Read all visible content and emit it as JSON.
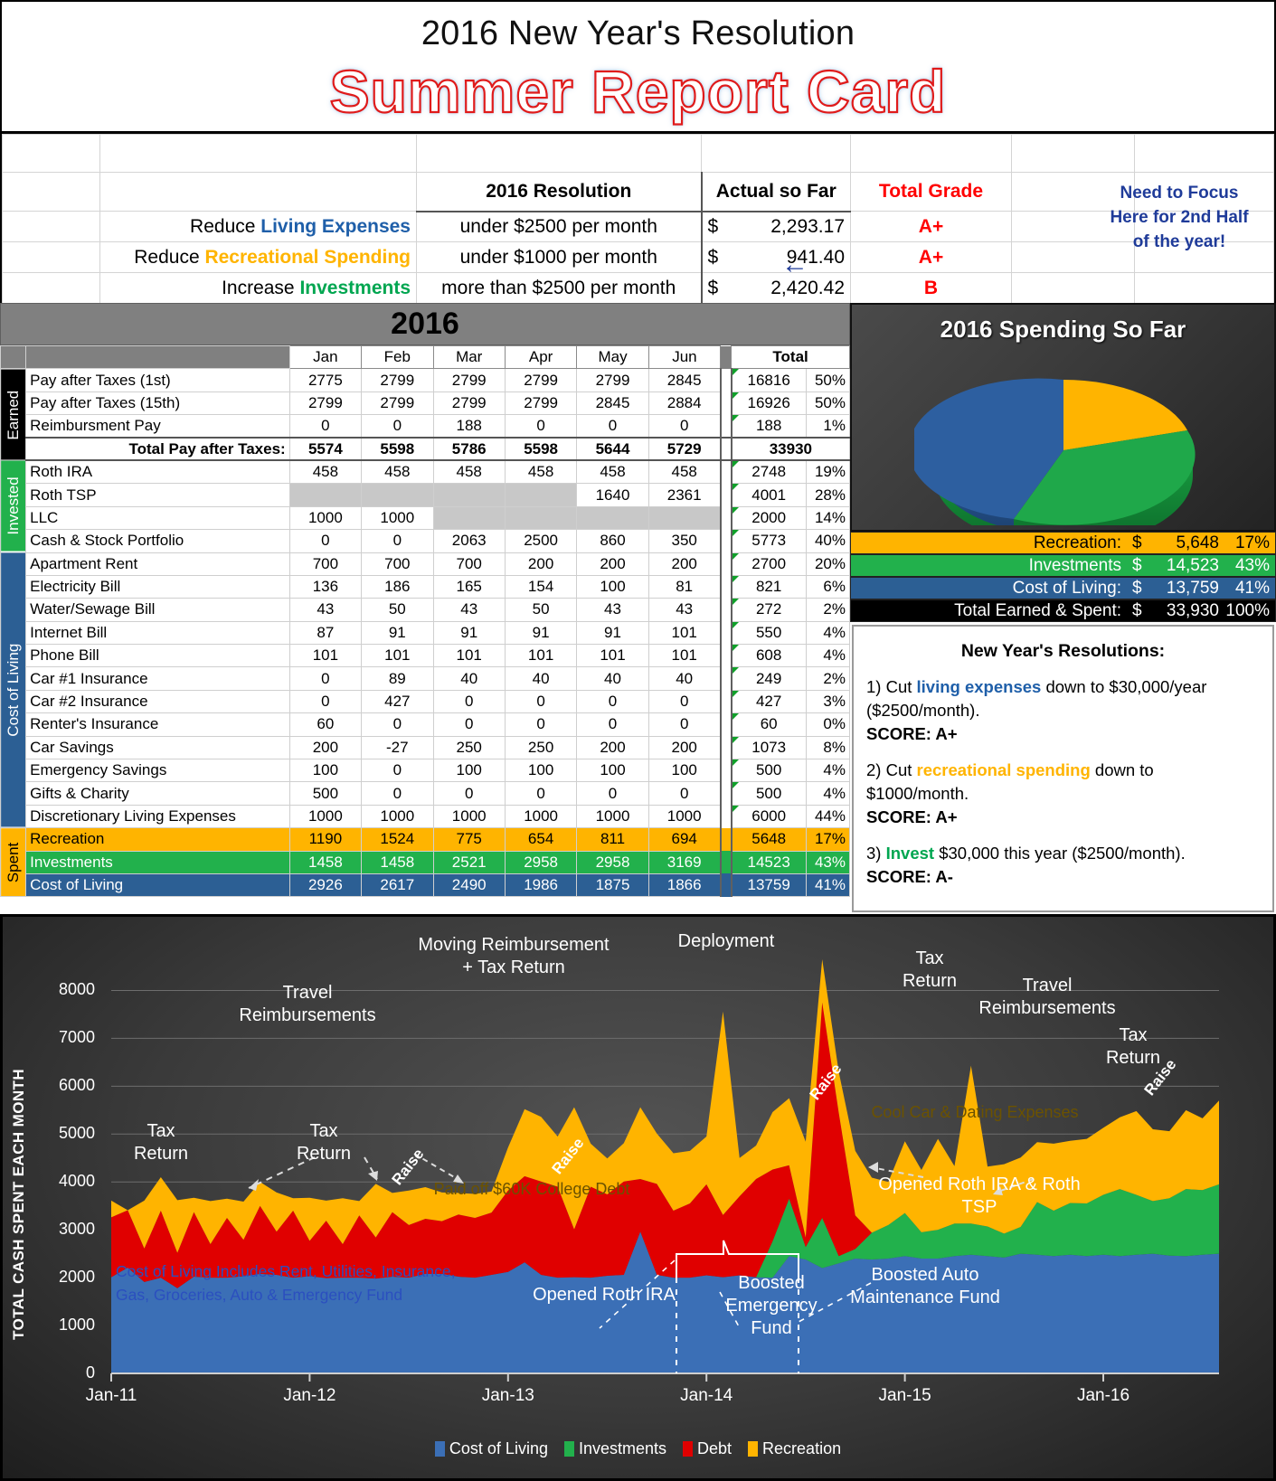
{
  "title": {
    "subtitle": "2016 New Year's Resolution",
    "main": "Summer Report Card"
  },
  "summary": {
    "headers": {
      "resolution": "2016 Resolution",
      "actual": "Actual so Far",
      "grade": "Total Grade"
    },
    "rows": [
      {
        "prefix": "Reduce ",
        "highlight": "Living Expenses",
        "highlight_color": "#1f5fa9",
        "target": "under $2500 per month",
        "dollar": "$",
        "amount": "2,293.17",
        "grade": "A+"
      },
      {
        "prefix": "Reduce ",
        "highlight": "Recreational Spending",
        "highlight_color": "#ffb400",
        "target": "under $1000 per month",
        "dollar": "$",
        "amount": "941.40",
        "grade": "A+"
      },
      {
        "prefix": "Increase ",
        "highlight": "Investments",
        "highlight_color": "#00a650",
        "target": "more than $2500 per month",
        "dollar": "$",
        "amount": "2,420.42",
        "grade": "B"
      }
    ],
    "focus_note": "Need to Focus Here for 2nd Half of the year!",
    "focus_line1": "Need to Focus",
    "focus_line2": "Here for 2nd Half",
    "focus_line3": "of the year!",
    "arrow": "←"
  },
  "budget": {
    "year": "2016",
    "months": [
      "Jan",
      "Feb",
      "Mar",
      "Apr",
      "May",
      "Jun"
    ],
    "total_header": "Total",
    "side_labels": {
      "earned": "Earned",
      "invested": "Invested",
      "cost_of_living": "Cost of Living",
      "spent": "Spent"
    },
    "earned_rows": [
      {
        "label": "Pay after Taxes (1st)",
        "values": [
          "2775",
          "2799",
          "2799",
          "2799",
          "2799",
          "2845"
        ],
        "total": "16816",
        "pct": "50%"
      },
      {
        "label": "Pay after Taxes (15th)",
        "values": [
          "2799",
          "2799",
          "2799",
          "2799",
          "2845",
          "2884"
        ],
        "total": "16926",
        "pct": "50%"
      },
      {
        "label": "Reimbursment Pay",
        "values": [
          "0",
          "0",
          "188",
          "0",
          "0",
          "0"
        ],
        "total": "188",
        "pct": "1%"
      }
    ],
    "total_row": {
      "label": "Total Pay after Taxes:",
      "values": [
        "5574",
        "5598",
        "5786",
        "5598",
        "5644",
        "5729"
      ],
      "total": "33930",
      "pct": ""
    },
    "invested_rows": [
      {
        "label": "Roth IRA",
        "values": [
          "458",
          "458",
          "458",
          "458",
          "458",
          "458"
        ],
        "total": "2748",
        "pct": "19%"
      },
      {
        "label": "Roth TSP",
        "values": [
          "",
          "",
          "",
          "",
          "1640",
          "2361"
        ],
        "total": "4001",
        "pct": "28%"
      },
      {
        "label": "LLC",
        "values": [
          "1000",
          "1000",
          "",
          "",
          "",
          ""
        ],
        "total": "2000",
        "pct": "14%"
      },
      {
        "label": "Cash & Stock Portfolio",
        "values": [
          "0",
          "0",
          "2063",
          "2500",
          "860",
          "350"
        ],
        "total": "5773",
        "pct": "40%"
      }
    ],
    "col_rows": [
      {
        "label": "Apartment Rent",
        "values": [
          "700",
          "700",
          "700",
          "200",
          "200",
          "200"
        ],
        "total": "2700",
        "pct": "20%"
      },
      {
        "label": "Electricity Bill",
        "values": [
          "136",
          "186",
          "165",
          "154",
          "100",
          "81"
        ],
        "total": "821",
        "pct": "6%"
      },
      {
        "label": "Water/Sewage Bill",
        "values": [
          "43",
          "50",
          "43",
          "50",
          "43",
          "43"
        ],
        "total": "272",
        "pct": "2%"
      },
      {
        "label": "Internet Bill",
        "values": [
          "87",
          "91",
          "91",
          "91",
          "91",
          "101"
        ],
        "total": "550",
        "pct": "4%"
      },
      {
        "label": "Phone Bill",
        "values": [
          "101",
          "101",
          "101",
          "101",
          "101",
          "101"
        ],
        "total": "608",
        "pct": "4%"
      },
      {
        "label": "Car #1 Insurance",
        "values": [
          "0",
          "89",
          "40",
          "40",
          "40",
          "40"
        ],
        "total": "249",
        "pct": "2%"
      },
      {
        "label": "Car #2 Insurance",
        "values": [
          "0",
          "427",
          "0",
          "0",
          "0",
          "0"
        ],
        "total": "427",
        "pct": "3%"
      },
      {
        "label": "Renter's Insurance",
        "values": [
          "60",
          "0",
          "0",
          "0",
          "0",
          "0"
        ],
        "total": "60",
        "pct": "0%"
      },
      {
        "label": "Car Savings",
        "values": [
          "200",
          "-27",
          "250",
          "250",
          "200",
          "200"
        ],
        "total": "1073",
        "pct": "8%"
      },
      {
        "label": "Emergency Savings",
        "values": [
          "100",
          "0",
          "100",
          "100",
          "100",
          "100"
        ],
        "total": "500",
        "pct": "4%"
      },
      {
        "label": "Gifts & Charity",
        "values": [
          "500",
          "0",
          "0",
          "0",
          "0",
          "0"
        ],
        "total": "500",
        "pct": "4%"
      },
      {
        "label": "Discretionary Living Expenses",
        "values": [
          "1000",
          "1000",
          "1000",
          "1000",
          "1000",
          "1000"
        ],
        "total": "6000",
        "pct": "44%"
      }
    ],
    "spent_rows": [
      {
        "label": "Recreation",
        "values": [
          "1190",
          "1524",
          "775",
          "654",
          "811",
          "694"
        ],
        "total": "5648",
        "pct": "17%",
        "style": "r-rec"
      },
      {
        "label": "Investments",
        "values": [
          "1458",
          "1458",
          "2521",
          "2958",
          "2958",
          "3169"
        ],
        "total": "14523",
        "pct": "43%",
        "style": "r-inv"
      },
      {
        "label": "Cost of Living",
        "values": [
          "2926",
          "2617",
          "2490",
          "1986",
          "1875",
          "1866"
        ],
        "total": "13759",
        "pct": "41%",
        "style": "r-col"
      }
    ]
  },
  "pie": {
    "title": "2016 Spending So Far",
    "legend": [
      {
        "label": "Recreation:",
        "dollar": "$",
        "amount": "5,648",
        "pct": "17%",
        "style": "lg-rec"
      },
      {
        "label": "Investments",
        "dollar": "$",
        "amount": "14,523",
        "pct": "43%",
        "style": "lg-inv"
      },
      {
        "label": "Cost of Living:",
        "dollar": "$",
        "amount": "13,759",
        "pct": "41%",
        "style": "lg-col"
      },
      {
        "label": "Total Earned & Spent:",
        "dollar": "$",
        "amount": "33,930",
        "pct": "100%",
        "style": "lg-tot"
      }
    ]
  },
  "resolutions": {
    "heading": "New Year's Resolutions:",
    "items": [
      {
        "pre": "1) Cut ",
        "hl": "living expenses",
        "hl_color": "#1f5fa9",
        "post": " down to $30,000/year ($2500/month).",
        "score": "SCORE: A+"
      },
      {
        "pre": "2) Cut ",
        "hl": "recreational spending",
        "hl_color": "#ffb400",
        "post": " down to $1000/month.",
        "score": "SCORE: A+"
      },
      {
        "pre": "3) ",
        "hl": "Invest",
        "hl_color": "#00a650",
        "post": " $30,000 this year ($2500/month).",
        "score": "SCORE: A-"
      }
    ]
  },
  "chart_data": {
    "type": "area",
    "title": "",
    "xlabel": "",
    "ylabel": "TOTAL CASH SPENT EACH MONTH",
    "ylim": [
      0,
      8500
    ],
    "yticks": [
      0,
      1000,
      2000,
      3000,
      4000,
      5000,
      6000,
      7000,
      8000
    ],
    "xticks": [
      "Jan-11",
      "Jan-12",
      "Jan-13",
      "Jan-14",
      "Jan-15",
      "Jan-16"
    ],
    "grid": true,
    "legend_position": "bottom",
    "stacked": true,
    "legend": [
      "Cost of Living",
      "Investments",
      "Debt",
      "Recreation"
    ],
    "colors": {
      "Cost of Living": "#3b6fb6",
      "Investments": "#22b14c",
      "Debt": "#e00000",
      "Recreation": "#ffb400"
    },
    "series": [
      {
        "name": "Cost of Living",
        "color": "#3b6fb6",
        "values": [
          2010,
          2210,
          1910,
          2000,
          1780,
          2020,
          2000,
          2000,
          2030,
          2080,
          2060,
          2000,
          2030,
          1990,
          2000,
          2000,
          1980,
          2020,
          2000,
          2080,
          2080,
          2020,
          2000,
          2060,
          2120,
          2320,
          2060,
          2000,
          2010,
          2000,
          2040,
          2060,
          2960,
          2060,
          2000,
          2000,
          2050,
          2010,
          2050,
          2010,
          2000,
          2450,
          2380,
          2200,
          2300,
          2400,
          2380,
          2400,
          2450,
          2400,
          2400,
          2450,
          2480,
          2450,
          2420,
          2500,
          2480,
          2450,
          2480,
          2450,
          2480,
          2450,
          2480,
          2500,
          2460,
          2450,
          2480,
          2500
        ]
      },
      {
        "name": "Investments",
        "color": "#22b14c",
        "values": [
          0,
          0,
          0,
          0,
          0,
          0,
          0,
          0,
          0,
          0,
          0,
          0,
          0,
          0,
          0,
          0,
          0,
          0,
          0,
          0,
          0,
          0,
          0,
          0,
          0,
          0,
          0,
          0,
          0,
          0,
          0,
          0,
          0,
          0,
          0,
          0,
          0,
          0,
          0,
          0,
          760,
          1200,
          260,
          1050,
          150,
          200,
          560,
          700,
          900,
          550,
          600,
          680,
          650,
          620,
          500,
          560,
          1100,
          950,
          1080,
          1100,
          1250,
          1400,
          1250,
          1100,
          1200,
          1400,
          1350,
          1450
        ]
      },
      {
        "name": "Debt",
        "color": "#e00000",
        "values": [
          1250,
          1200,
          700,
          1400,
          740,
          1350,
          700,
          1250,
          760,
          1420,
          900,
          1400,
          740,
          1200,
          700,
          1300,
          860,
          1350,
          1100,
          1150,
          1100,
          1300,
          1250,
          1300,
          1700,
          1800,
          1950,
          1900,
          1000,
          1900,
          1700,
          1950,
          1100,
          1900,
          1400,
          1550,
          1900,
          1300,
          1650,
          2050,
          1500,
          700,
          200,
          4500,
          3000,
          700,
          0,
          0,
          0,
          0,
          0,
          0,
          0,
          0,
          0,
          0,
          0,
          0,
          0,
          0,
          0,
          0,
          0,
          0,
          0,
          0,
          0,
          0
        ]
      },
      {
        "name": "Recreation",
        "color": "#ffb400",
        "values": [
          350,
          0,
          1000,
          700,
          1100,
          300,
          900,
          400,
          800,
          500,
          820,
          260,
          900,
          420,
          960,
          300,
          1120,
          400,
          720,
          660,
          600,
          450,
          500,
          440,
          900,
          1400,
          1350,
          1050,
          2550,
          900,
          750,
          800,
          1500,
          1050,
          1200,
          1100,
          1000,
          4250,
          800,
          700,
          1200,
          1400,
          2000,
          900,
          850,
          1350,
          1150,
          900,
          1500,
          1300,
          1900,
          1200,
          3300,
          1250,
          1450,
          1450,
          1250,
          1400,
          1300,
          1350,
          1400,
          1500,
          1750,
          1500,
          1400,
          1650,
          1500,
          1750
        ]
      }
    ],
    "annotations": [
      {
        "text": "Tax Return",
        "x": 0.1,
        "y": 0.62
      },
      {
        "text": "Travel Reimbursements",
        "x": 0.235,
        "y": 0.17
      },
      {
        "text": "Tax Return",
        "x": 0.245,
        "y": 0.65
      },
      {
        "text": "Moving Reimbursement + Tax Return",
        "x": 0.4,
        "y": 0.06
      },
      {
        "text": "Raise",
        "x": 0.3,
        "y": 0.69
      },
      {
        "text": "Raise",
        "x": 0.435,
        "y": 0.655
      },
      {
        "text": "Deployment",
        "x": 0.565,
        "y": 0.02
      },
      {
        "text": "Raise",
        "x": 0.625,
        "y": 0.63
      },
      {
        "text": "Tax Return",
        "x": 0.715,
        "y": 0.12
      },
      {
        "text": "Travel Reimbursements",
        "x": 0.8,
        "y": 0.15
      },
      {
        "text": "Tax Return",
        "x": 0.875,
        "y": 0.25
      },
      {
        "text": "Raise",
        "x": 0.905,
        "y": 0.315
      },
      {
        "text": "Paid off $60K College Debt",
        "x": 0.41,
        "y": 0.53
      },
      {
        "text": "Opened Roth IRA",
        "x": 0.465,
        "y": 0.875
      },
      {
        "text": "Boosted Emergency Fund",
        "x": 0.595,
        "y": 0.86
      },
      {
        "text": "Boosted Auto Maintenance Fund",
        "x": 0.705,
        "y": 0.845
      },
      {
        "text": "Opened Roth IRA & Roth TSP",
        "x": 0.755,
        "y": 0.63
      },
      {
        "text": "Cool Car & Dating Expenses",
        "x": 0.75,
        "y": 0.425
      },
      {
        "text": "Cost of Living Includes Rent, Utilities, Insurance, Gas, Groceries, Auto & Emergency Fund",
        "x": 0.09,
        "y": 0.8
      }
    ]
  }
}
